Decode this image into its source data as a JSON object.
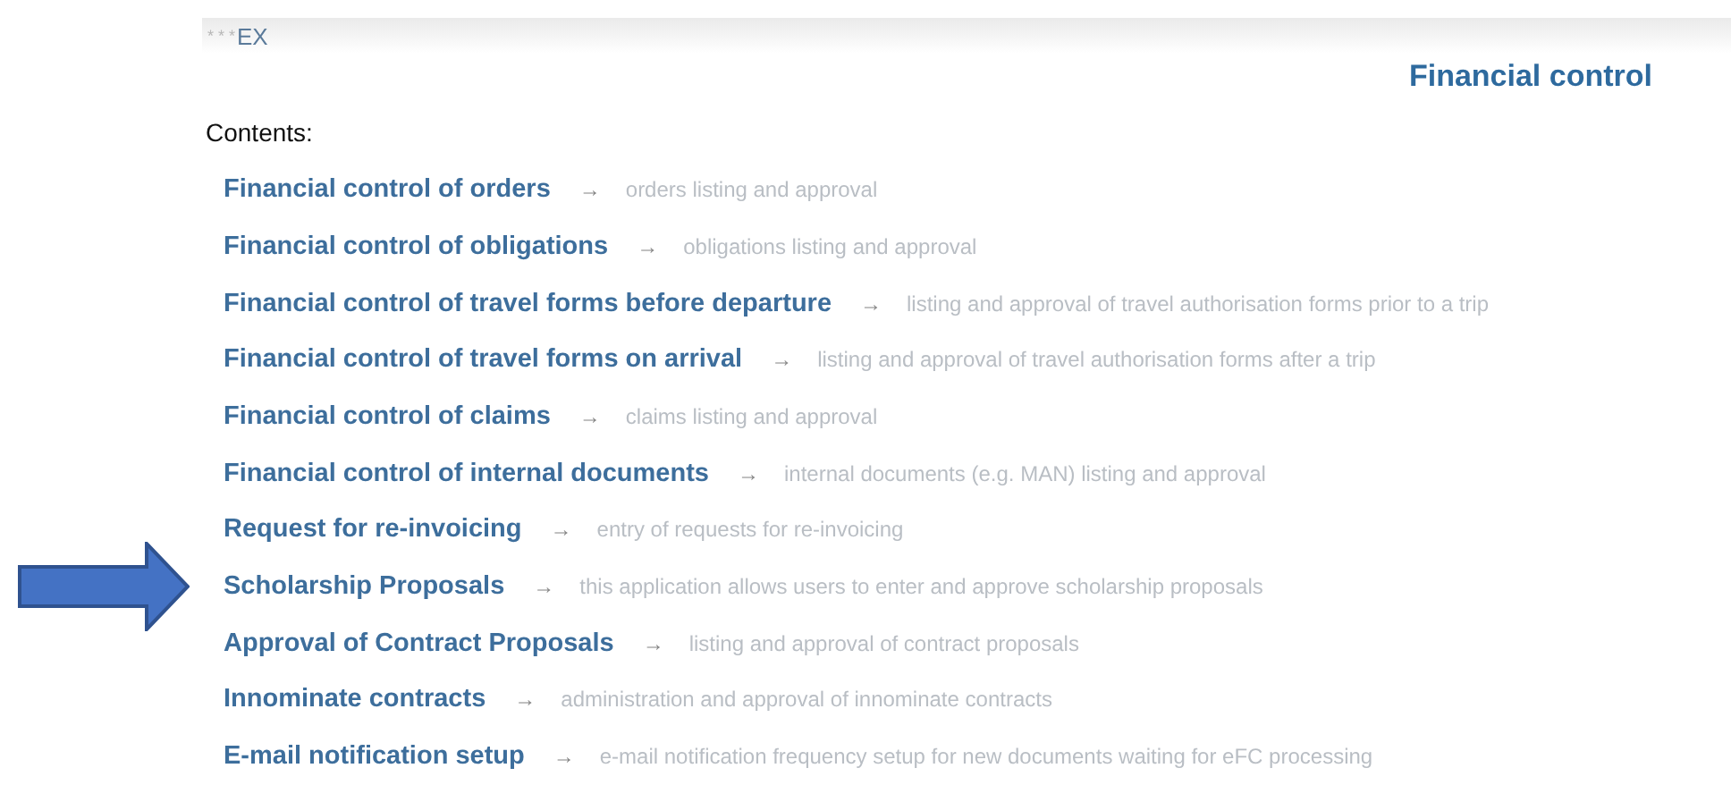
{
  "header": {
    "masked": "* * *",
    "label": "EX"
  },
  "title": "Financial control",
  "contents_label": "Contents:",
  "items": [
    {
      "link": "Financial control of orders",
      "arrow": "→",
      "description": "orders listing and approval",
      "pointed": false
    },
    {
      "link": "Financial control of obligations",
      "arrow": "→",
      "description": "obligations listing and approval",
      "pointed": false
    },
    {
      "link": "Financial control of travel forms before departure",
      "arrow": "→",
      "description": "listing and approval of travel authorisation forms prior to a trip",
      "pointed": false
    },
    {
      "link": "Financial control of travel forms on arrival",
      "arrow": "→",
      "description": "listing and approval of travel authorisation forms after a trip",
      "pointed": false
    },
    {
      "link": "Financial control of claims",
      "arrow": "→",
      "description": "claims listing and approval",
      "pointed": false
    },
    {
      "link": "Financial control of internal documents",
      "arrow": "→",
      "description": "internal documents (e.g. MAN) listing and approval",
      "pointed": false
    },
    {
      "link": "Request for re-invoicing",
      "arrow": "→",
      "description": "entry of requests for re-invoicing",
      "pointed": false
    },
    {
      "link": "Scholarship Proposals",
      "arrow": "→",
      "description": "this application allows users to enter and approve scholarship proposals",
      "pointed": true
    },
    {
      "link": "Approval of Contract Proposals",
      "arrow": "→",
      "description": "listing and approval of contract proposals",
      "pointed": false
    },
    {
      "link": "Innominate contracts",
      "arrow": "→",
      "description": "administration and approval of innominate contracts",
      "pointed": false
    },
    {
      "link": "E-mail notification setup",
      "arrow": "→",
      "description": "e-mail notification frequency setup for new documents waiting for eFC processing",
      "pointed": false
    }
  ]
}
